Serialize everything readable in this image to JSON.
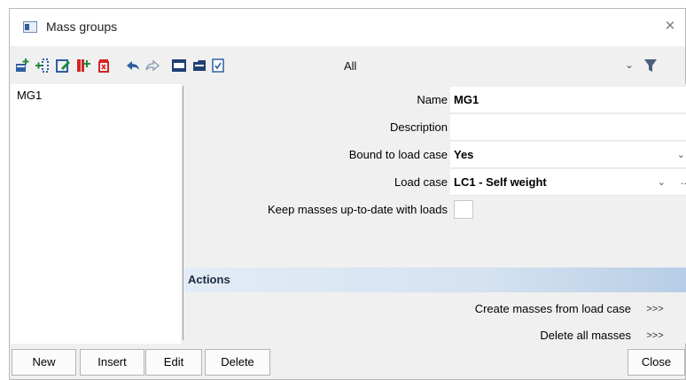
{
  "window": {
    "title": "Mass groups",
    "icon": "window-icon",
    "close_glyph": "×"
  },
  "toolbar": {
    "icons": [
      "new-row-icon",
      "insert-row-icon",
      "edit-icon",
      "duplicate-icon",
      "delete-icon",
      "undo-icon",
      "redo-icon",
      "table-icon",
      "folder-icon",
      "check-icon"
    ],
    "filter_value": "All",
    "filter_chevron": "⌄",
    "filter_icon": "funnel-icon"
  },
  "list": {
    "items": [
      "MG1"
    ]
  },
  "properties": {
    "name": {
      "label": "Name",
      "value": "MG1"
    },
    "description": {
      "label": "Description",
      "value": ""
    },
    "bound_to_load_case": {
      "label": "Bound to load case",
      "value": "Yes",
      "dropdown": "⌄"
    },
    "load_case": {
      "label": "Load case",
      "value": "LC1 - Self weight",
      "dropdown": "⌄",
      "more": ".."
    },
    "keep_masses": {
      "label": "Keep masses up-to-date with loads",
      "checked": false
    }
  },
  "actions": {
    "title": "Actions",
    "items": [
      {
        "label": "Create masses from load case",
        "button": ">>>"
      },
      {
        "label": "Delete all masses",
        "button": ">>>"
      }
    ]
  },
  "buttons": {
    "new": "New",
    "insert": "Insert",
    "edit": "Edit",
    "delete": "Delete",
    "close": "Close"
  },
  "colors": {
    "accent": "#2d5fa1",
    "delete_red": "#d32424",
    "section_header": "#d4e2f1"
  }
}
